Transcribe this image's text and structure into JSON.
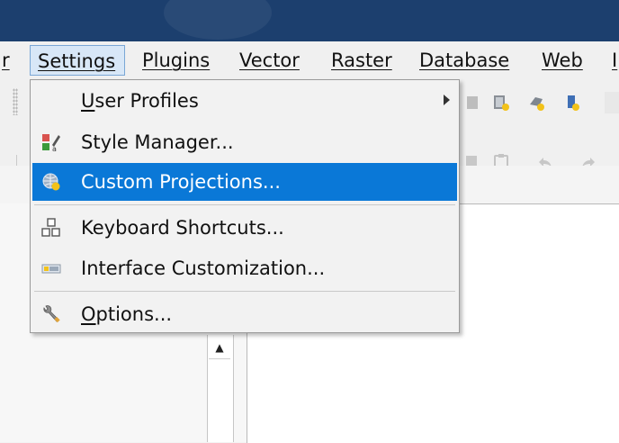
{
  "menubar": {
    "items": [
      {
        "label": "r"
      },
      {
        "label": "Settings"
      },
      {
        "label": "Plugins"
      },
      {
        "label": "Vector"
      },
      {
        "label": "Raster"
      },
      {
        "label": "Database"
      },
      {
        "label": "Web"
      },
      {
        "label": "I"
      }
    ]
  },
  "settings_menu": {
    "user_profiles": {
      "mnemonic": "U",
      "rest": "ser Profiles"
    },
    "style_manager": {
      "label": "Style Manager..."
    },
    "custom_projections": {
      "label": "Custom Projections..."
    },
    "keyboard_shortcuts": {
      "label": "Keyboard Shortcuts..."
    },
    "interface_customization": {
      "label": "Interface Customization..."
    },
    "options": {
      "mnemonic": "O",
      "rest": "ptions..."
    }
  },
  "colors": {
    "titlebar": "#1c3f6e",
    "selection": "#0a78d7",
    "menu_bg": "#f2f2f2"
  },
  "icons": [
    "style-manager-icon",
    "globe-projection-icon",
    "keyboard-shortcuts-icon",
    "interface-customization-icon",
    "wrench-icon",
    "submenu-arrow-icon"
  ]
}
